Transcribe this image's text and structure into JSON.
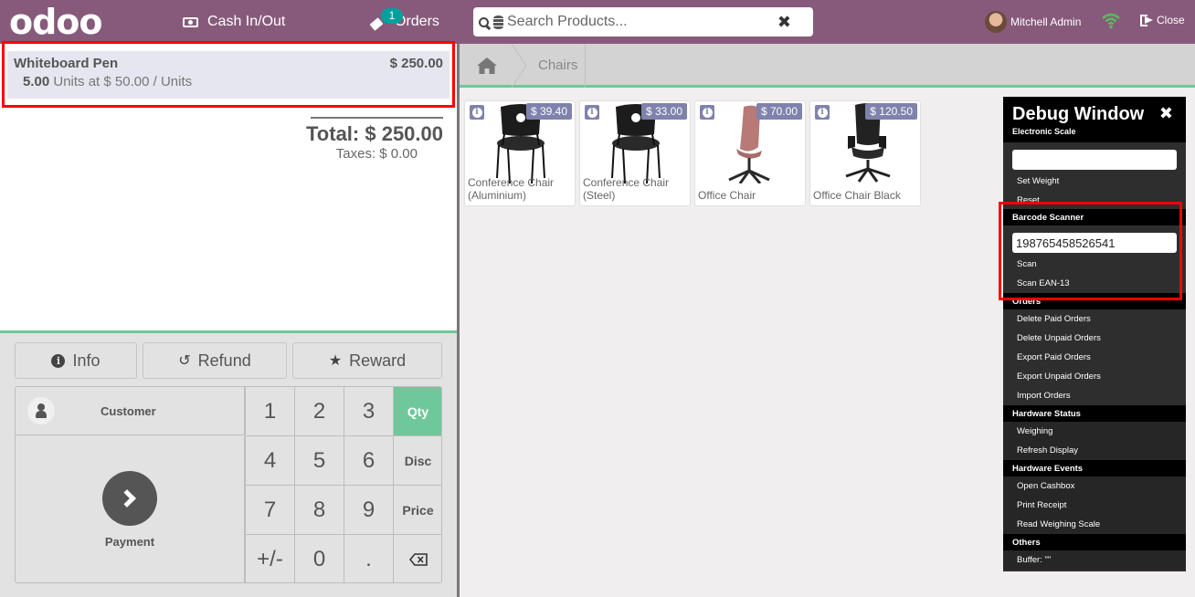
{
  "header": {
    "logo": "odoo",
    "cash_label": "Cash In/Out",
    "orders_label": "Orders",
    "orders_count": "1",
    "search_placeholder": "Search Products...",
    "user_name": "Mitchell Admin",
    "close_label": "Close"
  },
  "order": {
    "lines": [
      {
        "name": "Whiteboard Pen",
        "price": "$ 250.00",
        "qty": "5.00",
        "detail": "Units at $ 50.00 / Units"
      }
    ],
    "total": "Total: $ 250.00",
    "taxes": "Taxes: $ 0.00"
  },
  "controls": {
    "info": "Info",
    "refund": "Refund",
    "reward": "Reward",
    "customer": "Customer",
    "payment": "Payment",
    "keys": [
      "1",
      "2",
      "3",
      "4",
      "5",
      "6",
      "7",
      "8",
      "9",
      "+/-",
      "0",
      "."
    ],
    "modes": [
      "Qty",
      "Disc",
      "Price"
    ],
    "active_mode": "Qty"
  },
  "breadcrumb": {
    "category": "Chairs"
  },
  "products": [
    {
      "name": "Conference Chair (Aluminium)",
      "price": "$ 39.40"
    },
    {
      "name": "Conference Chair (Steel)",
      "price": "$ 33.00"
    },
    {
      "name": "Office Chair",
      "price": "$ 70.00"
    },
    {
      "name": "Office Chair Black",
      "price": "$ 120.50"
    }
  ],
  "debug": {
    "title": "Debug Window",
    "electronic_scale": "Electronic Scale",
    "scale_value": "",
    "set_weight": "Set Weight",
    "reset": "Reset",
    "barcode_scanner": "Barcode Scanner",
    "barcode_value": "198765458526541",
    "scan": "Scan",
    "scan_ean13": "Scan EAN-13",
    "orders": "Orders",
    "orders_items": [
      "Delete Paid Orders",
      "Delete Unpaid Orders",
      "Export Paid Orders",
      "Export Unpaid Orders",
      "Import Orders"
    ],
    "hardware_status": "Hardware Status",
    "status_items": [
      "Weighing",
      "Refresh Display"
    ],
    "hardware_events": "Hardware Events",
    "events_items": [
      "Open Cashbox",
      "Print Receipt",
      "Read Weighing Scale"
    ],
    "others": "Others",
    "buffer": "Buffer: \"\""
  },
  "colors": {
    "brand": "#875a7b",
    "accent_green": "#6ec89b",
    "badge": "#00a09d",
    "price_tag": "#7f82ac",
    "highlight": "#ff0000"
  }
}
